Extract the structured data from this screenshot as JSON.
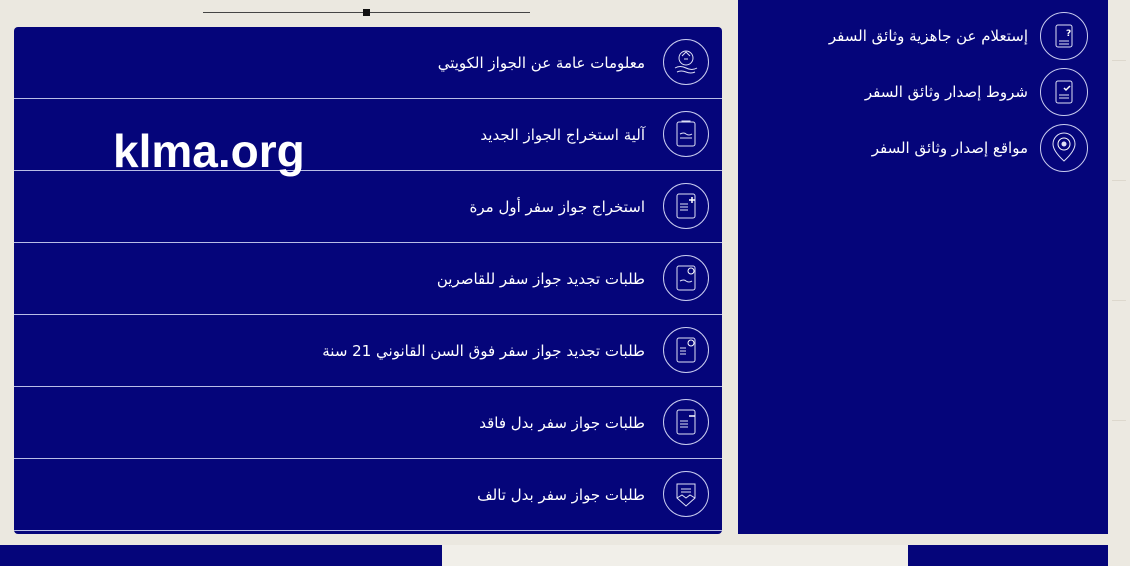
{
  "left_menu": {
    "items": [
      {
        "label": "معلومات عامة عن الجواز الكويتي",
        "icon": "emblem-icon"
      },
      {
        "label": "آلية استخراج الجواز الجديد",
        "icon": "passport-document-icon"
      },
      {
        "label": "استخراج جواز سفر أول مرة",
        "icon": "passport-add-icon"
      },
      {
        "label": "طلبات تجديد جواز سفر للقاصرين",
        "icon": "passport-renew-icon"
      },
      {
        "label": "طلبات تجديد جواز سفر فوق السن القانوني 21 سنة",
        "icon": "passport-renew-adult-icon"
      },
      {
        "label": "طلبات جواز سفر بدل فاقد",
        "icon": "passport-lost-icon"
      },
      {
        "label": "طلبات جواز سفر بدل تالف",
        "icon": "passport-damaged-icon"
      }
    ]
  },
  "right_menu": {
    "items": [
      {
        "label": "إستعلام عن جاهزية وثائق السفر",
        "icon": "document-question-icon"
      },
      {
        "label": "شروط إصدار وثائق السفر",
        "icon": "document-check-icon"
      },
      {
        "label": "مواقع إصدار وثائق السفر",
        "icon": "location-pin-icon"
      }
    ]
  },
  "watermark": "klma.org",
  "colors": {
    "panel": "#05057a",
    "background": "#ebe8e0",
    "text": "#ffffff"
  }
}
